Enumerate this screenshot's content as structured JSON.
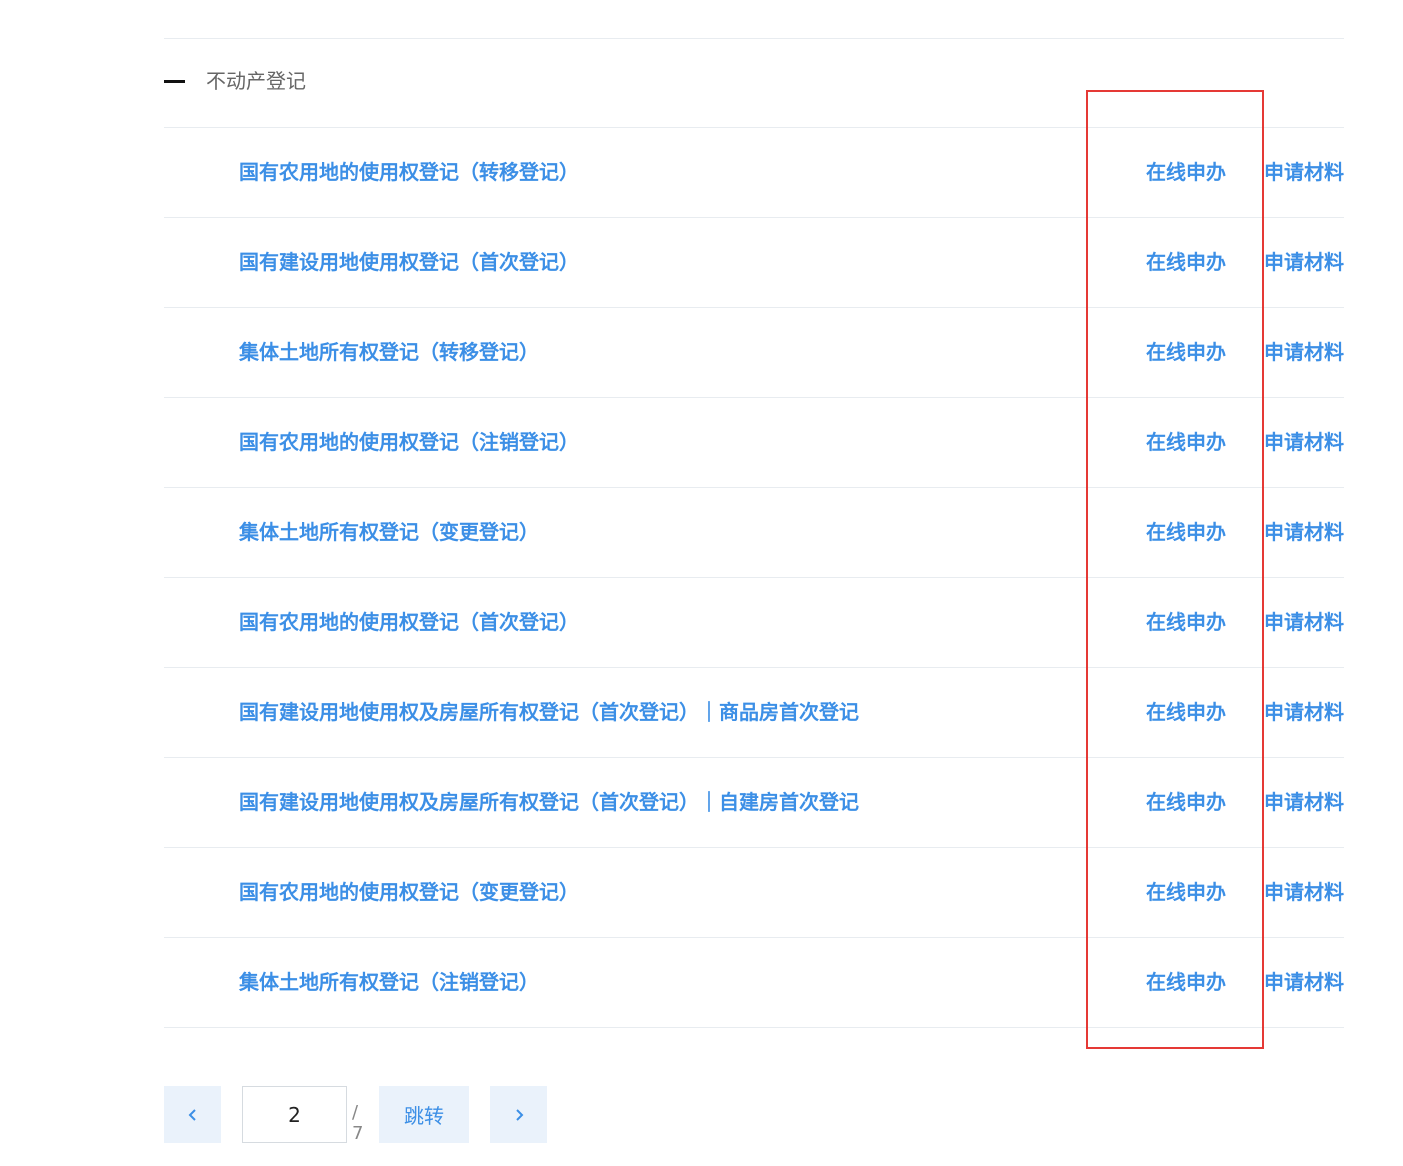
{
  "section": {
    "title": "不动产登记"
  },
  "items": [
    {
      "title": "国有农用地的使用权登记（转移登记）",
      "apply": "在线申办",
      "materials": "申请材料"
    },
    {
      "title": "国有建设用地使用权登记（首次登记）",
      "apply": "在线申办",
      "materials": "申请材料"
    },
    {
      "title": "集体土地所有权登记（转移登记）",
      "apply": "在线申办",
      "materials": "申请材料"
    },
    {
      "title": "国有农用地的使用权登记（注销登记）",
      "apply": "在线申办",
      "materials": "申请材料"
    },
    {
      "title": "集体土地所有权登记（变更登记）",
      "apply": "在线申办",
      "materials": "申请材料"
    },
    {
      "title": "国有农用地的使用权登记（首次登记）",
      "apply": "在线申办",
      "materials": "申请材料"
    },
    {
      "title": "国有建设用地使用权及房屋所有权登记（首次登记）｜商品房首次登记",
      "apply": "在线申办",
      "materials": "申请材料"
    },
    {
      "title": "国有建设用地使用权及房屋所有权登记（首次登记）｜自建房首次登记",
      "apply": "在线申办",
      "materials": "申请材料"
    },
    {
      "title": "国有农用地的使用权登记（变更登记）",
      "apply": "在线申办",
      "materials": "申请材料"
    },
    {
      "title": "集体土地所有权登记（注销登记）",
      "apply": "在线申办",
      "materials": "申请材料"
    }
  ],
  "pagination": {
    "current_page": "2",
    "total_label": "/ 7",
    "jump_label": "跳转",
    "prev_icon": "chevron-left-icon",
    "next_icon": "chevron-right-icon"
  },
  "colors": {
    "link": "#3c8fe6",
    "highlight": "#e53935",
    "pager_bg": "#eaf2fb"
  }
}
